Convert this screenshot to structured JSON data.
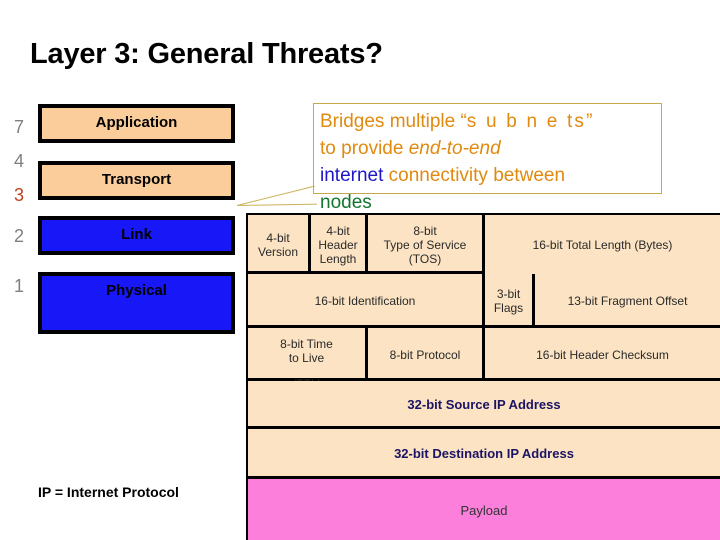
{
  "slide": {
    "title": "Layer 3: General Threats?",
    "footer_legend": "IP = Internet Protocol"
  },
  "layers": [
    {
      "number": "7",
      "label": "Application",
      "fill": "#fbcd9b",
      "number_color": "#7f7f7f"
    },
    {
      "number": "4",
      "label": "Transport",
      "fill": "#fbcd9b",
      "number_color": "#7f7f7f"
    },
    {
      "number": "3",
      "label": "",
      "fill": "",
      "number_color": "#c0431d"
    },
    {
      "number": "2",
      "label": "Link",
      "fill": "#1717f7",
      "number_color": "#7f7f7f"
    },
    {
      "number": "1",
      "label": "Physical",
      "fill": "#1717f7",
      "number_color": "#7f7f7f"
    }
  ],
  "callout": {
    "line1_a": "Bridges multiple “",
    "line1_b": "s u b n e ts",
    "line1_c": "”",
    "line2_a": "to provide ",
    "line2_b": "end-to-end",
    "line3_a": "internet",
    "line3_b": " connectivity between",
    "line4": "nodes",
    "border_color": "#c8a84a",
    "text_color": "#e08a10",
    "internet_color": "#1e14c8",
    "nodes_color": "#14762e"
  },
  "ip_header": {
    "rows": [
      {
        "cells": [
          {
            "text": "4-bit\nVersion"
          },
          {
            "text": "4-bit\nHeader\nLength"
          },
          {
            "text": "8-bit\nType of Service\n(TOS)"
          },
          {
            "text": "16-bit Total Length (Bytes)"
          }
        ]
      },
      {
        "cells": [
          {
            "text": "16-bit Identification"
          },
          {
            "text": "3-bit\nFlags"
          },
          {
            "text": "13-bit Fragment Offset"
          }
        ]
      },
      {
        "cells": [
          {
            "text": "8-bit Time\nto Live"
          },
          {
            "text": "8-bit Protocol"
          },
          {
            "text": "16-bit Header Checksum"
          }
        ],
        "overflow_text": "(TTL)"
      },
      {
        "cells": [
          {
            "text": "32-bit Source IP Address"
          }
        ]
      },
      {
        "cells": [
          {
            "text": "32-bit Destination IP Address"
          }
        ]
      },
      {
        "cells": [
          {
            "text": "Payload"
          }
        ]
      }
    ],
    "header_fill": "#fbe3c3",
    "payload_fill": "#fc7fdb",
    "address_text_color": "#1b1464"
  }
}
